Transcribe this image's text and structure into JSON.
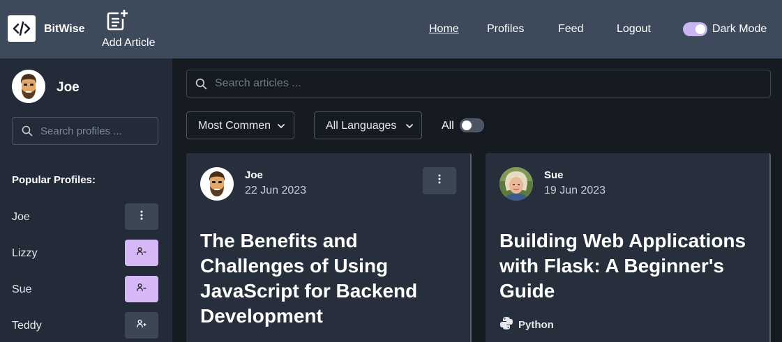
{
  "app": {
    "brand": "BitWise"
  },
  "nav": {
    "add_article": "Add Article",
    "links": [
      "Home",
      "Profiles",
      "Feed",
      "Logout"
    ],
    "dark_mode_label": "Dark Mode",
    "dark_mode_on": true
  },
  "sidebar": {
    "user_name": "Joe",
    "search_placeholder": "Search profiles ...",
    "popular_title": "Popular Profiles:",
    "profiles": [
      {
        "name": "Joe",
        "action_icon": "more-vertical-icon"
      },
      {
        "name": "Lizzy",
        "action_icon": "unfollow-user-icon"
      },
      {
        "name": "Sue",
        "action_icon": "unfollow-user-icon"
      },
      {
        "name": "Teddy",
        "action_icon": "follow-user-icon"
      }
    ]
  },
  "main": {
    "search_placeholder": "Search articles ...",
    "sort_selected": "Most Commen",
    "language_selected": "All Languages",
    "all_label": "All",
    "all_toggle_on": false
  },
  "articles": [
    {
      "author": "Joe",
      "date": "22 Jun 2023",
      "title": "The Benefits and Challenges of Using JavaScript for Backend Development",
      "language": ""
    },
    {
      "author": "Sue",
      "date": "19 Jun 2023",
      "title": "Building Web Applications with Flask: A Beginner's Guide",
      "language": "Python"
    }
  ],
  "colors": {
    "topbar": "#3d4a5c",
    "sidebar": "#222b37",
    "background": "#161b22",
    "card": "#262f3b",
    "accent": "#d5b8f5"
  }
}
